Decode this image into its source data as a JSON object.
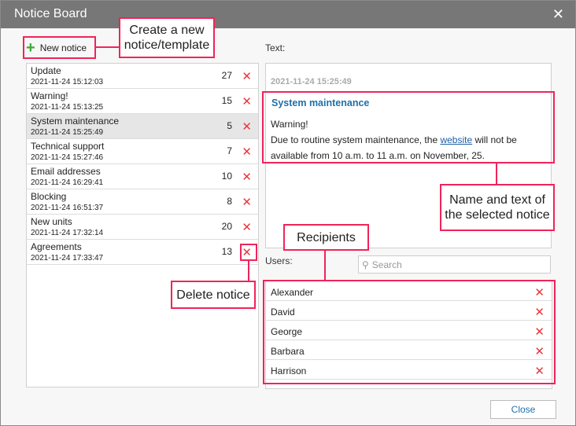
{
  "window": {
    "title": "Notice Board"
  },
  "toolbar": {
    "new_notice_label": "New notice"
  },
  "notices": [
    {
      "name": "Update",
      "date": "2021-11-24 15:12:03",
      "count": "27"
    },
    {
      "name": "Warning!",
      "date": "2021-11-24 15:13:25",
      "count": "15"
    },
    {
      "name": "System maintenance",
      "date": "2021-11-24 15:25:49",
      "count": "5",
      "selected": true
    },
    {
      "name": "Technical support",
      "date": "2021-11-24 15:27:46",
      "count": "7"
    },
    {
      "name": "Email addresses",
      "date": "2021-11-24 16:29:41",
      "count": "10"
    },
    {
      "name": "Blocking",
      "date": "2021-11-24 16:51:37",
      "count": "8"
    },
    {
      "name": "New units",
      "date": "2021-11-24 17:32:14",
      "count": "20"
    },
    {
      "name": "Agreements",
      "date": "2021-11-24 17:33:47",
      "count": "13"
    }
  ],
  "detail": {
    "text_label": "Text:",
    "timestamp": "2021-11-24 15:25:49",
    "title": "System maintenance",
    "line1": "Warning!",
    "body_pre": "Due to routine system maintenance, the ",
    "link": "website",
    "body_post": " will not be available from 10 a.m. to 11 a.m. on November, 25."
  },
  "recipients": {
    "users_label": "Users:",
    "search_placeholder": "Search",
    "users": [
      "Alexander",
      "David",
      "George",
      "Barbara",
      "Harrison"
    ]
  },
  "footer": {
    "close_label": "Close"
  },
  "callouts": {
    "create": "Create a new notice/template",
    "name_text": "Name and text of the selected notice",
    "recipients": "Recipients",
    "delete": "Delete notice"
  },
  "colors": {
    "accent": "#f0245a",
    "title_bar": "#777777",
    "link": "#1f6fa8",
    "delete": "#e8383d"
  }
}
